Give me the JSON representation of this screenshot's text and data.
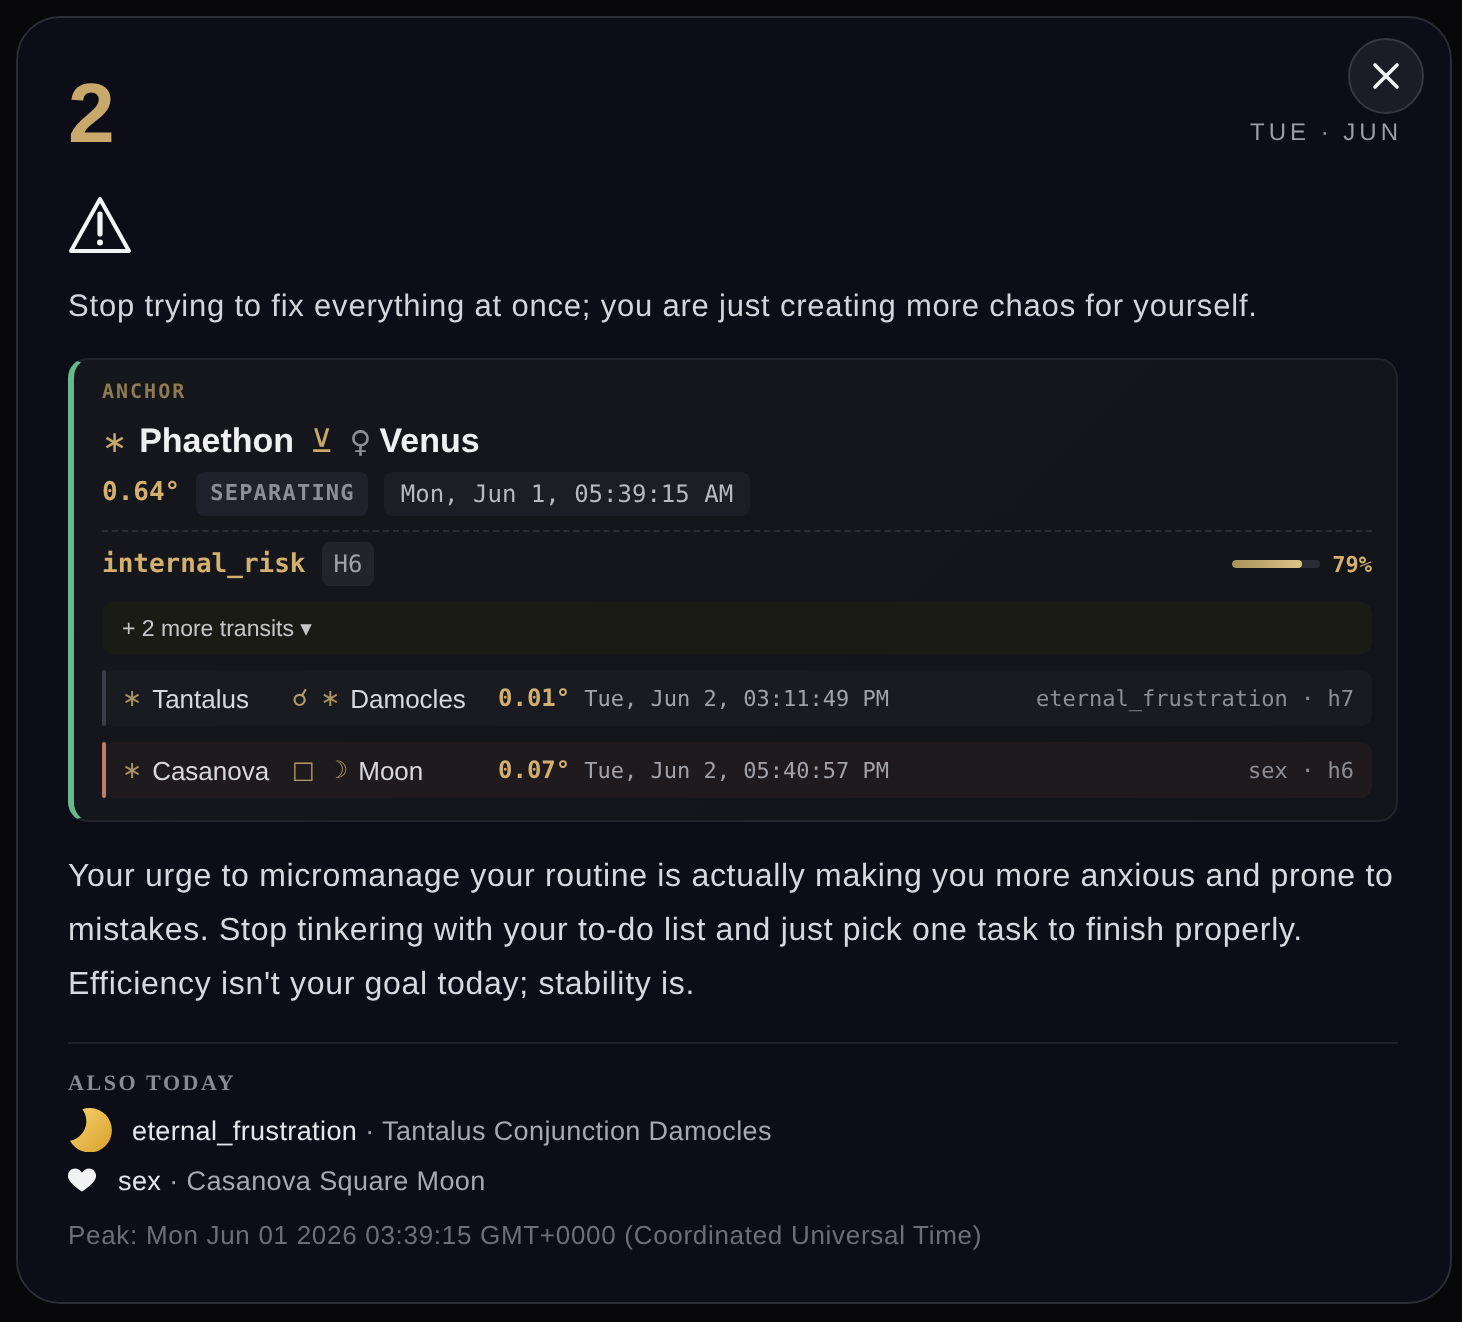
{
  "header": {
    "day": "2",
    "date_label": "TUE · JUN"
  },
  "headline": "Stop trying to fix everything at once; you are just creating more chaos for yourself.",
  "anchor": {
    "label": "ANCHOR",
    "body1_symbol": "∗",
    "body1": "Phaethon",
    "aspect_symbol": "⊻",
    "body2_symbol": "♀",
    "body2": "Venus",
    "orb": "0.64°",
    "motion": "SEPARATING",
    "time": "Mon, Jun 1, 05:39:15 AM",
    "theme": "internal_risk",
    "house": "H6",
    "level": 0.79,
    "percent": "79%",
    "more_button": "+ 2 more transits ▾",
    "transits": [
      {
        "body1_symbol": "∗",
        "body1": "Tantalus",
        "aspect_symbol": "☌",
        "body2_symbol": "∗",
        "body2": "Damocles",
        "orb": "0.01°",
        "time": "Tue, Jun 2, 03:11:49 PM",
        "tag": "eternal_frustration · h7",
        "color": "#3c3d47"
      },
      {
        "body1_symbol": "∗",
        "body1": "Casanova",
        "aspect_symbol": "□",
        "body2_symbol": "☽",
        "body2": "Moon",
        "orb": "0.07°",
        "time": "Tue, Jun 2, 05:40:57 PM",
        "tag": "sex · h6",
        "color": "#c47c6a"
      }
    ]
  },
  "body": "Your urge to micromanage your routine is actually making you more anxious and prone to mistakes. Stop tinkering with your to-do list and just pick one task to finish properly. Efficiency isn't your goal today; stability is.",
  "also_today": {
    "title": "ALSO TODAY",
    "items": [
      {
        "kind": "moon",
        "theme": "eternal_frustration",
        "detail": "· Tantalus Conjunction Damocles"
      },
      {
        "kind": "heart",
        "theme": "sex",
        "detail": "· Casanova Square Moon"
      }
    ]
  },
  "peak": "Peak: Mon Jun 01 2026 03:39:15 GMT+0000 (Coordinated Universal Time)"
}
